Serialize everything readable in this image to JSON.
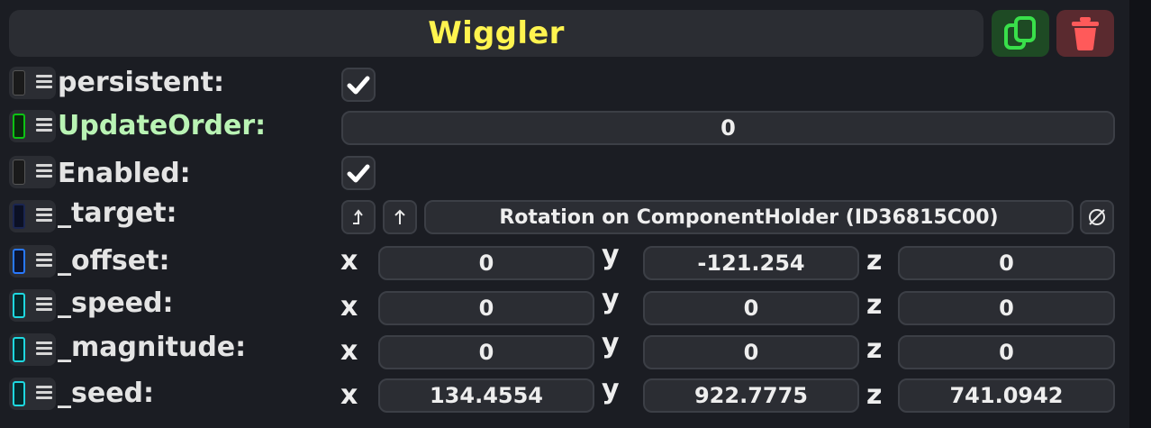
{
  "component": {
    "title": "Wiggler",
    "copy_icon": "copy-icon",
    "delete_icon": "trash-icon",
    "colors": {
      "title": "#fff44f",
      "copy_bg": "#1e4a24",
      "copy_icon": "#39e04a",
      "delete_bg": "#5a2a2f",
      "delete_icon": "#ff5a5a"
    }
  },
  "properties": {
    "persistent": {
      "label": "persistent:",
      "checked": true,
      "swatch_color": "#1a1a1a"
    },
    "update_order": {
      "label": "UpdateOrder:",
      "value": "0",
      "label_color": "#b9f3b4",
      "swatch_color": "#0ec214"
    },
    "enabled": {
      "label": "Enabled:",
      "checked": true,
      "swatch_color": "#1a1a1a"
    },
    "target": {
      "label": "_target:",
      "value": "Rotation on ComponentHolder (ID36815C00)",
      "swatch_color": "#1a2550",
      "pick_icon": "arrow-curve-up-icon",
      "up_icon": "arrow-up-icon",
      "clear_icon": "null-icon"
    },
    "offset": {
      "label": "_offset:",
      "x_label": "x",
      "y_label": "y",
      "z_label": "z",
      "x": "0",
      "y": "-121.254",
      "z": "0",
      "swatch_color": "#2878ff"
    },
    "speed": {
      "label": "_speed:",
      "x_label": "x",
      "y_label": "y",
      "z_label": "z",
      "x": "0",
      "y": "0",
      "z": "0",
      "swatch_color": "#1ed8e0"
    },
    "magnitude": {
      "label": "_magnitude:",
      "x_label": "x",
      "y_label": "y",
      "z_label": "z",
      "x": "0",
      "y": "0",
      "z": "0",
      "swatch_color": "#1ed8e0"
    },
    "seed": {
      "label": "_seed:",
      "x_label": "x",
      "y_label": "y",
      "z_label": "z",
      "x": "134.4554",
      "y": "922.7775",
      "z": "741.0942",
      "swatch_color": "#1ed8e0"
    }
  }
}
